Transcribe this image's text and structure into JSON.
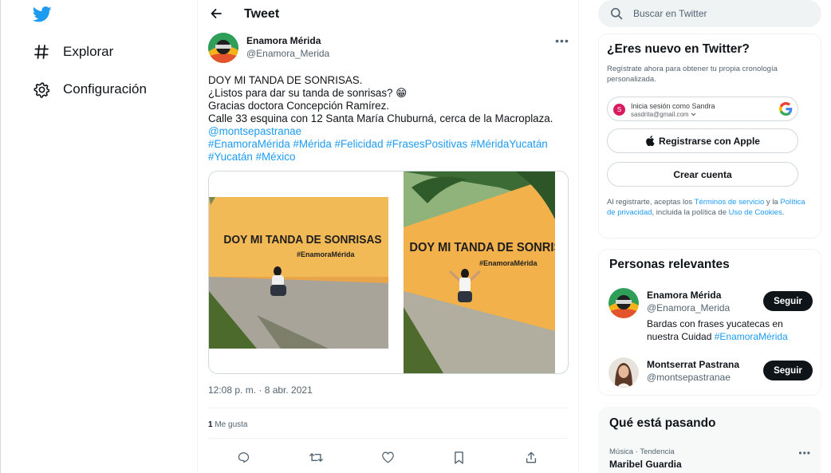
{
  "nav": {
    "logo_icon": "twitter-bird-icon",
    "items": [
      {
        "label": "Explorar",
        "icon": "hashtag-icon"
      },
      {
        "label": "Configuración",
        "icon": "gear-icon"
      }
    ]
  },
  "header": {
    "back_icon": "arrow-left-icon",
    "title": "Tweet"
  },
  "tweet": {
    "author_name": "Enamora Mérida",
    "author_handle": "@Enamora_Merida",
    "more_icon": "more-horizontal-icon",
    "lines": [
      "DOY MI TANDA DE SONRISAS.",
      "¿Listos para dar su tanda de sonrisas? 😁",
      "Gracias doctora Concepción Ramírez.",
      "Calle 33 esquina con 12 Santa María Chuburná, cerca de la Macroplaza."
    ],
    "mention": "@montsepastranae",
    "hashtags_line1": "#EnamoraMérida #Mérida #Felicidad #FrasesPositivas  #MéridaYucatán",
    "hashtags_line2": "#Yucatán #México",
    "photos": [
      {
        "wall_text": "DOY MI TANDA DE SONRISAS",
        "wall_tag": "#EnamoraMérida"
      },
      {
        "wall_text": "DOY MI TANDA DE SONRISAS",
        "wall_tag": "#EnamoraMérida"
      }
    ],
    "timestamp": "12:08 p. m. · 8 abr. 2021",
    "likes_count": "1",
    "likes_label": "Me gusta",
    "actions": [
      "reply-icon",
      "retweet-icon",
      "like-icon",
      "bookmark-icon",
      "share-icon"
    ]
  },
  "search": {
    "placeholder": "Buscar en Twitter",
    "value": ""
  },
  "new_to_twitter": {
    "title": "¿Eres nuevo en Twitter?",
    "description": "Regístrate ahora para obtener tu propia cronología personalizada.",
    "google_line1": "Inicia sesión como Sandra",
    "google_line2": "sasdrita@gmail.com",
    "google_avatar_letter": "S",
    "apple_button": "Registrarse con Apple",
    "create_button": "Crear cuenta",
    "terms_prefix": "Al registrarte, aceptas los ",
    "terms_link": "Términos de servicio",
    "terms_mid1": " y la ",
    "privacy_link": "Política de privacidad",
    "terms_mid2": ", incluida la política de ",
    "cookies_link": "Uso de Cookies",
    "terms_end": "."
  },
  "relevant_people": {
    "title": "Personas relevantes",
    "people": [
      {
        "name": "Enamora Mérida",
        "handle": "@Enamora_Merida",
        "bio_text": "Bardas con frases yucatecas en nuestra Cuidad ",
        "bio_link": "#EnamoraMérida",
        "follow_label": "Seguir"
      },
      {
        "name": "Montserrat Pastrana",
        "handle": "@montsepastranae",
        "bio_text": "",
        "bio_link": "",
        "follow_label": "Seguir"
      }
    ]
  },
  "trends": {
    "title": "Qué está pasando",
    "items": [
      {
        "meta": "Música · Tendencia",
        "name": "Maribel Guardia"
      }
    ]
  },
  "colors": {
    "accent": "#1d9bf0",
    "text": "#0f1419",
    "muted": "#536471",
    "wall": "#f0b556"
  }
}
